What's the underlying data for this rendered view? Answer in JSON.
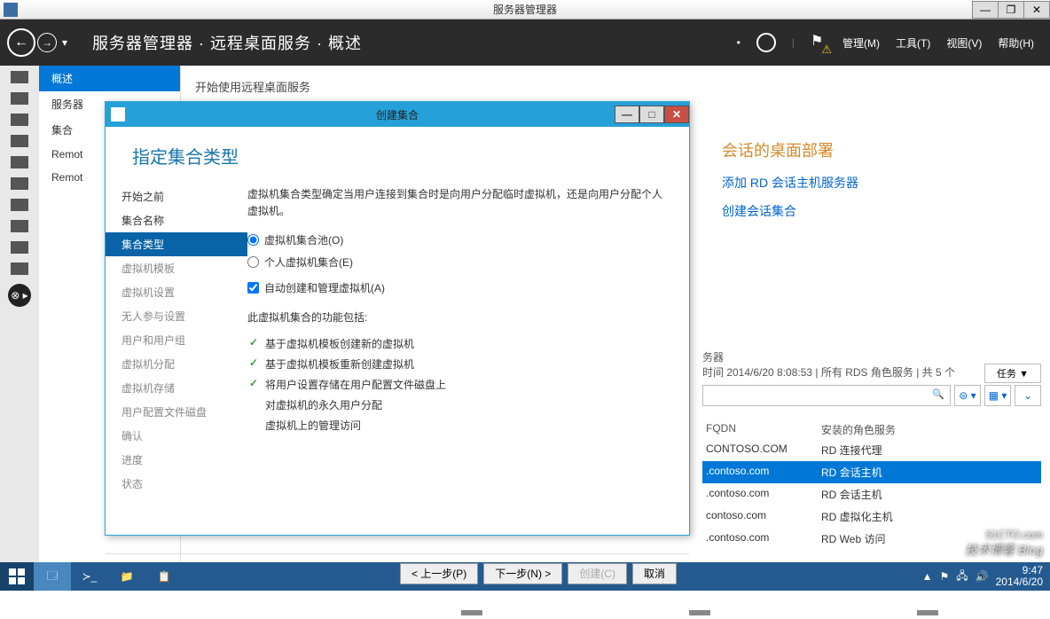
{
  "window": {
    "title": "服务器管理器",
    "min": "—",
    "max": "❐",
    "close": "✕"
  },
  "topbar": {
    "breadcrumb": "服务器管理器 · 远程桌面服务 · 概述",
    "menu": [
      "管理(M)",
      "工具(T)",
      "视图(V)",
      "帮助(H)"
    ]
  },
  "nav": {
    "items": [
      "概述",
      "服务器",
      "集合",
      "Remot",
      "Remot"
    ],
    "current": 0
  },
  "content": {
    "starter": "开始使用远程桌面服务"
  },
  "deploy": {
    "title": "会话的桌面部署",
    "links": [
      "添加 RD 会话主机服务器",
      "创建会话集合"
    ]
  },
  "servers": {
    "hdr_suffix": "务器",
    "status": "时间 2014/6/20 8:08:53 | 所有 RDS 角色服务 | 共 5 个",
    "tasks": "任务  ▼",
    "filter_hint": "筛选",
    "cols": [
      "FQDN",
      "安装的角色服务"
    ],
    "rows": [
      {
        "fqdn": "CONTOSO.COM",
        "role": "RD 连接代理",
        "sel": false
      },
      {
        "fqdn": ".contoso.com",
        "role": "RD 会话主机",
        "sel": true
      },
      {
        "fqdn": ".contoso.com",
        "role": "RD 会话主机",
        "sel": false
      },
      {
        "fqdn": "contoso.com",
        "role": "RD 虚拟化主机",
        "sel": false
      },
      {
        "fqdn": ".contoso.com",
        "role": "RD Web 访问",
        "sel": false
      }
    ]
  },
  "dialog": {
    "title": "创建集合",
    "heading": "指定集合类型",
    "steps": [
      "开始之前",
      "集合名称",
      "集合类型",
      "虚拟机模板",
      "虚拟机设置",
      "无人参与设置",
      "用户和用户组",
      "虚拟机分配",
      "虚拟机存储",
      "用户配置文件磁盘",
      "确认",
      "进度",
      "状态"
    ],
    "current_step": 2,
    "intro": "虚拟机集合类型确定当用户连接到集合时是向用户分配临时虚拟机，还是向用户分配个人虚拟机。",
    "radio1": "虚拟机集合池(O)",
    "radio2": "个人虚拟机集合(E)",
    "checkbox": "自动创建和管理虚拟机(A)",
    "feat_hdr": "此虚拟机集合的功能包括:",
    "feats": [
      {
        "t": "基于虚拟机模板创建新的虚拟机",
        "c": true
      },
      {
        "t": "基于虚拟机模板重新创建虚拟机",
        "c": true
      },
      {
        "t": "将用户设置存储在用户配置文件磁盘上",
        "c": true
      },
      {
        "t": "对虚拟机的永久用户分配",
        "c": false
      },
      {
        "t": "虚拟机上的管理访问",
        "c": false
      }
    ],
    "btn_prev": "< 上一步(P)",
    "btn_next": "下一步(N) >",
    "btn_create": "创建(C)",
    "btn_cancel": "取消"
  },
  "taskbar": {
    "time": "9:47",
    "date": "2014/6/20"
  },
  "watermark": {
    "a": "51CTO.com",
    "b": "技术博客  Blog"
  }
}
